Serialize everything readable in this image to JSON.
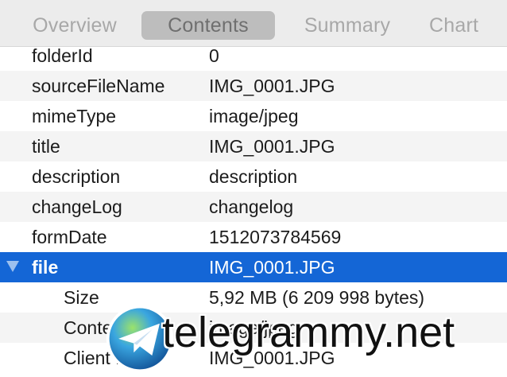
{
  "tabs": [
    {
      "label": "Overview",
      "selected": false
    },
    {
      "label": "Contents",
      "selected": true
    },
    {
      "label": "Summary",
      "selected": false
    },
    {
      "label": "Chart",
      "selected": false
    }
  ],
  "properties": [
    {
      "key": "folderId",
      "value": "0"
    },
    {
      "key": "sourceFileName",
      "value": "IMG_0001.JPG"
    },
    {
      "key": "mimeType",
      "value": "image/jpeg"
    },
    {
      "key": "title",
      "value": "IMG_0001.JPG"
    },
    {
      "key": "description",
      "value": "description"
    },
    {
      "key": "changeLog",
      "value": "changelog"
    },
    {
      "key": "formDate",
      "value": "1512073784569"
    },
    {
      "key": "file",
      "value": "IMG_0001.JPG",
      "expanded": true,
      "selected": true
    },
    {
      "key": "Size",
      "value": "5,92 MB (6 209 998 bytes)"
    },
    {
      "key": "Content Type",
      "value": "image/jpeg"
    },
    {
      "key": "Client Path",
      "value": "IMG_0001.JPG"
    }
  ],
  "watermark": {
    "text": "telegrammy.net",
    "icon": "telegram-logo-icon"
  },
  "colors": {
    "selection": "#1466d6",
    "tab_selected_bg": "#bdbdbd",
    "tab_text": "#a8a8a8",
    "alt_row": "#f4f4f4"
  }
}
